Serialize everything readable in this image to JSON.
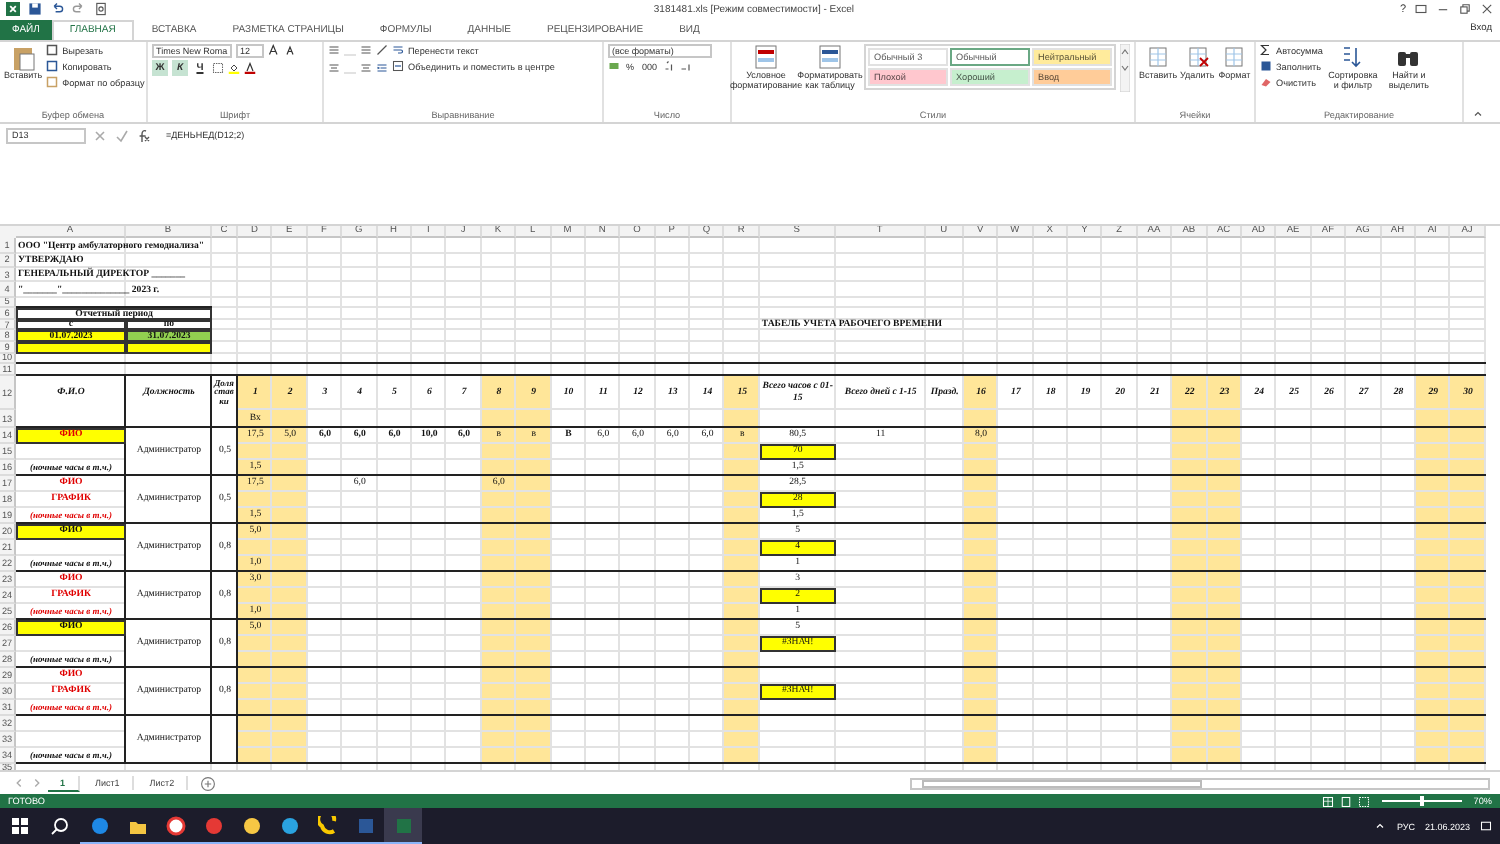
{
  "window": {
    "title": "3181481.xls  [Режим совместимости] - Excel",
    "help": "?",
    "sign_in": "Вход"
  },
  "tabs": [
    {
      "label": "ФАЙЛ",
      "kind": "file",
      "selected": false
    },
    {
      "label": "ГЛАВНАЯ",
      "kind": "tab",
      "selected": true
    },
    {
      "label": "ВСТАВКА",
      "kind": "tab",
      "selected": false
    },
    {
      "label": "РАЗМЕТКА СТРАНИЦЫ",
      "kind": "tab",
      "selected": false
    },
    {
      "label": "ФОРМУЛЫ",
      "kind": "tab",
      "selected": false
    },
    {
      "label": "ДАННЫЕ",
      "kind": "tab",
      "selected": false
    },
    {
      "label": "РЕЦЕНЗИРОВАНИЕ",
      "kind": "tab",
      "selected": false
    },
    {
      "label": "ВИД",
      "kind": "tab",
      "selected": false
    }
  ],
  "ribbon": {
    "clipboard": {
      "label": "Буфер обмена",
      "paste": "Вставить",
      "items": [
        "Вырезать",
        "Копировать",
        "Формат по образцу"
      ]
    },
    "font": {
      "label": "Шрифт",
      "font": "Times New Roma",
      "size": "12",
      "styles": [
        {
          "label": "Ж",
          "on": true
        },
        {
          "label": "К",
          "on": true
        },
        {
          "label": "Ч",
          "on": false
        }
      ]
    },
    "alignment": {
      "label": "Выравнивание",
      "wrap": "Перенести текст",
      "merge": "Объединить и поместить в центре"
    },
    "number": {
      "label": "Число",
      "format": "(все форматы)",
      "percent": "%",
      "thousands": "000"
    },
    "styles": {
      "label": "Стили",
      "buttons": [
        "Условное форматирование",
        "Форматировать как таблицу"
      ],
      "swatches": [
        {
          "label": "Обычный 3",
          "color": "#ffffff",
          "selected": false
        },
        {
          "label": "Обычный",
          "color": "#ffffff",
          "selected": true
        },
        {
          "label": "Нейтральный",
          "color": "#ffeb9c",
          "selected": false
        },
        {
          "label": "Плохой",
          "color": "#ffc7ce",
          "selected": false
        },
        {
          "label": "Хороший",
          "color": "#c6efce",
          "selected": false
        },
        {
          "label": "Ввод",
          "color": "#ffcc99",
          "selected": false
        }
      ]
    },
    "cells": {
      "label": "Ячейки",
      "buttons": [
        "Вставить",
        "Удалить",
        "Формат"
      ]
    },
    "editing": {
      "label": "Редактирование",
      "items": [
        "Автосумма",
        "Заполнить",
        "Очистить"
      ],
      "buttons": [
        "Сортировка и фильтр",
        "Найти и выделить"
      ]
    }
  },
  "formula_bar": {
    "name_box": "D13",
    "formula": "=ДЕНЬНЕД(D12;2)"
  },
  "sheet": {
    "columns": [
      {
        "letter": "A",
        "weekend": false
      },
      {
        "letter": "B",
        "weekend": false
      },
      {
        "letter": "C",
        "weekend": false
      },
      {
        "letter": "D",
        "weekend": true
      },
      {
        "letter": "E",
        "weekend": true
      },
      {
        "letter": "F",
        "weekend": false
      },
      {
        "letter": "G",
        "weekend": false
      },
      {
        "letter": "H",
        "weekend": false
      },
      {
        "letter": "I",
        "weekend": false
      },
      {
        "letter": "J",
        "weekend": false
      },
      {
        "letter": "K",
        "weekend": true
      },
      {
        "letter": "L",
        "weekend": true
      },
      {
        "letter": "M",
        "weekend": false
      },
      {
        "letter": "N",
        "weekend": false
      },
      {
        "letter": "O",
        "weekend": false
      },
      {
        "letter": "P",
        "weekend": false
      },
      {
        "letter": "Q",
        "weekend": false
      },
      {
        "letter": "R",
        "weekend": true
      },
      {
        "letter": "S",
        "weekend": false
      },
      {
        "letter": "T",
        "weekend": false
      },
      {
        "letter": "U",
        "weekend": false
      },
      {
        "letter": "V",
        "weekend": true
      },
      {
        "letter": "W",
        "weekend": false
      },
      {
        "letter": "X",
        "weekend": false
      },
      {
        "letter": "Y",
        "weekend": false
      },
      {
        "letter": "Z",
        "weekend": false
      },
      {
        "letter": "AA",
        "weekend": false
      },
      {
        "letter": "AB",
        "weekend": true
      },
      {
        "letter": "AC",
        "weekend": true
      },
      {
        "letter": "AD",
        "weekend": false
      },
      {
        "letter": "AE",
        "weekend": false
      },
      {
        "letter": "AF",
        "weekend": false
      },
      {
        "letter": "AG",
        "weekend": false
      },
      {
        "letter": "AH",
        "weekend": false
      },
      {
        "letter": "AI",
        "weekend": true
      },
      {
        "letter": "AJ",
        "weekend": true
      }
    ],
    "rows": [
      {
        "number": "1",
        "cells": {
          "A": {
            "text": "ООО \"Центр амбулаторного гемодиализа\"",
            "kind": "title"
          }
        }
      },
      {
        "number": "2",
        "cells": {
          "A": {
            "text": "УТВЕРЖДАЮ",
            "kind": "title"
          }
        }
      },
      {
        "number": "3",
        "cells": {
          "A": {
            "text": "ГЕНЕРАЛЬНЫЙ   ДИРЕКТОР _______",
            "kind": "title"
          }
        }
      },
      {
        "number": "4",
        "cells": {
          "A": {
            "text": "\"_______\"______________ 2023 г.",
            "kind": "title"
          }
        }
      },
      {
        "number": "5",
        "cells": {}
      },
      {
        "number": "6",
        "cells": {
          "A": {
            "text": "Отчетный период",
            "kind": "period"
          }
        }
      },
      {
        "number": "7",
        "cells": {
          "A": {
            "text": "с",
            "kind": "label"
          },
          "B": {
            "text": "по",
            "kind": "label"
          },
          "S": {
            "text": "ТАБЕЛЬ УЧЕТА РАБОЧЕГО ВРЕМЕНИ",
            "kind": "title"
          }
        }
      },
      {
        "number": "8",
        "cells": {
          "A": {
            "text": "01.07.2023",
            "kind": "label",
            "color": "#ffff00"
          },
          "B": {
            "text": "31.07.2023",
            "kind": "label",
            "color": "#92d050"
          }
        }
      },
      {
        "number": "9",
        "cells": {
          "A": {
            "kind": "label",
            "color": "#ffff00"
          },
          "B": {
            "kind": "label",
            "color": "#ffff00"
          }
        }
      },
      {
        "number": "10",
        "cells": {}
      },
      {
        "number": "11",
        "cells": {}
      },
      {
        "number": "12",
        "cells": {
          "A": {
            "text": "Ф.И.О",
            "kind": "head"
          },
          "B": {
            "text": "Должность",
            "kind": "head"
          },
          "C": {
            "text": "Доля ставки",
            "kind": "narrow"
          },
          "D": {
            "text": "1",
            "kind": "day"
          },
          "E": {
            "text": "2",
            "kind": "day"
          },
          "F": {
            "text": "3",
            "kind": "day"
          },
          "G": {
            "text": "4",
            "kind": "day"
          },
          "H": {
            "text": "5",
            "kind": "day"
          },
          "I": {
            "text": "6",
            "kind": "day"
          },
          "J": {
            "text": "7",
            "kind": "day"
          },
          "K": {
            "text": "8",
            "kind": "day"
          },
          "L": {
            "text": "9",
            "kind": "day"
          },
          "M": {
            "text": "10",
            "kind": "day"
          },
          "N": {
            "text": "11",
            "kind": "day"
          },
          "O": {
            "text": "12",
            "kind": "day"
          },
          "P": {
            "text": "13",
            "kind": "day"
          },
          "Q": {
            "text": "14",
            "kind": "day"
          },
          "R": {
            "text": "15",
            "kind": "day"
          },
          "S": {
            "text": "Всего часов с 01-15",
            "kind": "head"
          },
          "T": {
            "text": "Всего дней с 1-15",
            "kind": "head"
          },
          "U": {
            "text": "Празд.",
            "kind": "head"
          },
          "V": {
            "text": "16",
            "kind": "day"
          },
          "W": {
            "text": "17",
            "kind": "day"
          },
          "X": {
            "text": "18",
            "kind": "day"
          },
          "Y": {
            "text": "19",
            "kind": "day"
          },
          "Z": {
            "text": "20",
            "kind": "day"
          },
          "AA": {
            "text": "21",
            "kind": "day"
          },
          "AB": {
            "text": "22",
            "kind": "day"
          },
          "AC": {
            "text": "23",
            "kind": "day"
          },
          "AD": {
            "text": "24",
            "kind": "day"
          },
          "AE": {
            "text": "25",
            "kind": "day"
          },
          "AF": {
            "text": "26",
            "kind": "day"
          },
          "AG": {
            "text": "27",
            "kind": "day"
          },
          "AH": {
            "text": "28",
            "kind": "day"
          },
          "AI": {
            "text": "29",
            "kind": "day"
          },
          "AJ": {
            "text": "30",
            "kind": "day"
          }
        }
      },
      {
        "number": "13",
        "cells": {
          "D": {
            "text": "Вх",
            "kind": "value"
          }
        }
      },
      {
        "number": "14",
        "cells": {
          "A": {
            "text": "ФИО",
            "kind": "name-red",
            "color": "#ffff00"
          },
          "D": {
            "text": "17,5",
            "kind": "value"
          },
          "E": {
            "text": "5,0",
            "kind": "value"
          },
          "F": {
            "text": "6,0",
            "kind": "bold"
          },
          "G": {
            "text": "6,0",
            "kind": "bold"
          },
          "H": {
            "text": "6,0",
            "kind": "bold"
          },
          "I": {
            "text": "10,0",
            "kind": "bold"
          },
          "J": {
            "text": "6,0",
            "kind": "bold"
          },
          "K": {
            "text": "в",
            "kind": "value"
          },
          "L": {
            "text": "в",
            "kind": "value"
          },
          "M": {
            "text": "В",
            "kind": "bold"
          },
          "N": {
            "text": "6,0",
            "kind": "value"
          },
          "O": {
            "text": "6,0",
            "kind": "value"
          },
          "P": {
            "text": "6,0",
            "kind": "value"
          },
          "Q": {
            "text": "6,0",
            "kind": "value"
          },
          "R": {
            "text": "в",
            "kind": "value"
          },
          "S": {
            "text": "80,5",
            "kind": "value"
          },
          "T": {
            "text": "11",
            "kind": "value"
          },
          "V": {
            "text": "8,0",
            "kind": "value"
          }
        }
      },
      {
        "number": "15",
        "cells": {
          "B": {
            "text": "Администратор",
            "kind": "value"
          },
          "C": {
            "text": "0,5",
            "kind": "value"
          },
          "S": {
            "text": "70",
            "kind": "value",
            "color": "#ffff00"
          }
        }
      },
      {
        "number": "16",
        "cells": {
          "A": {
            "text": "(ночные часы в т.ч.)",
            "kind": "note"
          },
          "D": {
            "text": "1,5",
            "kind": "value"
          },
          "S": {
            "text": "1,5",
            "kind": "value"
          }
        }
      },
      {
        "number": "17",
        "cells": {
          "A": {
            "text": "ФИО",
            "kind": "name-red"
          },
          "D": {
            "text": "17,5",
            "kind": "value"
          },
          "G": {
            "text": "6,0",
            "kind": "value"
          },
          "K": {
            "text": "6,0",
            "kind": "value"
          },
          "S": {
            "text": "28,5",
            "kind": "value"
          }
        }
      },
      {
        "number": "18",
        "cells": {
          "A": {
            "text": "ГРАФИК",
            "kind": "name-red"
          },
          "B": {
            "text": "Администратор",
            "kind": "value"
          },
          "C": {
            "text": "0,5",
            "kind": "value"
          },
          "S": {
            "text": "28",
            "kind": "value",
            "color": "#ffff00"
          }
        }
      },
      {
        "number": "19",
        "cells": {
          "A": {
            "text": "(ночные часы в т.ч.)",
            "kind": "note-red"
          },
          "D": {
            "text": "1,5",
            "kind": "value"
          },
          "S": {
            "text": "1,5",
            "kind": "value"
          }
        }
      },
      {
        "number": "20",
        "cells": {
          "A": {
            "text": "ФИО",
            "kind": "name",
            "color": "#ffff00"
          },
          "D": {
            "text": "5,0",
            "kind": "value"
          },
          "S": {
            "text": "5",
            "kind": "value"
          }
        }
      },
      {
        "number": "21",
        "cells": {
          "B": {
            "text": "Администратор",
            "kind": "value"
          },
          "C": {
            "text": "0,8",
            "kind": "value"
          },
          "S": {
            "text": "4",
            "kind": "value",
            "color": "#ffff00"
          }
        }
      },
      {
        "number": "22",
        "cells": {
          "A": {
            "text": "(ночные часы в т.ч.)",
            "kind": "note"
          },
          "D": {
            "text": "1,0",
            "kind": "value"
          },
          "S": {
            "text": "1",
            "kind": "value"
          }
        }
      },
      {
        "number": "23",
        "cells": {
          "A": {
            "text": "ФИО",
            "kind": "name-red"
          },
          "D": {
            "text": "3,0",
            "kind": "value"
          },
          "S": {
            "text": "3",
            "kind": "value"
          }
        }
      },
      {
        "number": "24",
        "cells": {
          "A": {
            "text": "ГРАФИК",
            "kind": "name-red"
          },
          "B": {
            "text": "Администратор",
            "kind": "value"
          },
          "C": {
            "text": "0,8",
            "kind": "value"
          },
          "S": {
            "text": "2",
            "kind": "value",
            "color": "#ffff00"
          }
        }
      },
      {
        "number": "25",
        "cells": {
          "A": {
            "text": "(ночные часы в т.ч.)",
            "kind": "note-red"
          },
          "D": {
            "text": "1,0",
            "kind": "value"
          },
          "S": {
            "text": "1",
            "kind": "value"
          }
        }
      },
      {
        "number": "26",
        "cells": {
          "A": {
            "text": "ФИО",
            "kind": "name",
            "color": "#ffff00"
          },
          "D": {
            "text": "5,0",
            "kind": "value"
          },
          "S": {
            "text": "5",
            "kind": "value"
          }
        }
      },
      {
        "number": "27",
        "cells": {
          "B": {
            "text": "Администратор",
            "kind": "value"
          },
          "C": {
            "text": "0,8",
            "kind": "value"
          },
          "S": {
            "text": "#ЗНАЧ!",
            "kind": "value",
            "color": "#ffff00"
          }
        }
      },
      {
        "number": "28",
        "cells": {
          "A": {
            "text": "(ночные часы в т.ч.)",
            "kind": "note"
          }
        }
      },
      {
        "number": "29",
        "cells": {
          "A": {
            "text": "ФИО",
            "kind": "name-red"
          }
        }
      },
      {
        "number": "30",
        "cells": {
          "A": {
            "text": "ГРАФИК",
            "kind": "name-red"
          },
          "B": {
            "text": "Администратор",
            "kind": "value"
          },
          "C": {
            "text": "0,8",
            "kind": "value"
          },
          "S": {
            "text": "#ЗНАЧ!",
            "kind": "value",
            "color": "#ffff00"
          }
        }
      },
      {
        "number": "31",
        "cells": {
          "A": {
            "text": "(ночные часы в т.ч.)",
            "kind": "note-red"
          }
        }
      },
      {
        "number": "32",
        "cells": {}
      },
      {
        "number": "33",
        "cells": {
          "B": {
            "text": "Администратор",
            "kind": "value"
          }
        }
      },
      {
        "number": "34",
        "cells": {
          "A": {
            "text": "(ночные часы в т.ч.)",
            "kind": "note"
          }
        }
      },
      {
        "number": "35",
        "cells": {}
      }
    ]
  },
  "sheet_tabs": [
    {
      "label": "1",
      "selected": true
    },
    {
      "label": "Лист1",
      "selected": false
    },
    {
      "label": "Лист2",
      "selected": false
    }
  ],
  "status_bar": {
    "status": "ГОТОВО",
    "zoom": "70%",
    "level": 0.47
  },
  "taskbar": {
    "apps": [
      {
        "kind": "edge",
        "selected": false
      },
      {
        "kind": "folder",
        "selected": false
      },
      {
        "kind": "y-browser",
        "selected": false
      },
      {
        "kind": "y",
        "selected": false
      },
      {
        "kind": "chat",
        "selected": false
      },
      {
        "kind": "telegram",
        "selected": false
      },
      {
        "kind": "c",
        "selected": false
      },
      {
        "kind": "word",
        "selected": false
      },
      {
        "kind": "excel",
        "selected": true
      }
    ],
    "language": "РУС",
    "date": "21.06.2023"
  }
}
